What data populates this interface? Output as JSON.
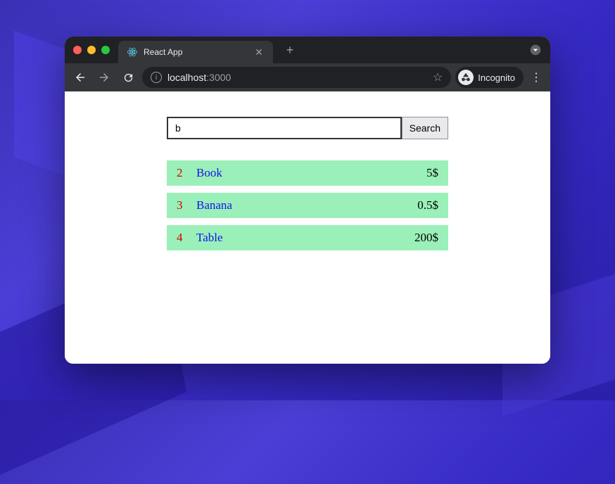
{
  "browser": {
    "tab_title": "React App",
    "url_host": "localhost",
    "url_port": ":3000",
    "incognito_label": "Incognito"
  },
  "app": {
    "search_value": "b",
    "search_button": "Search",
    "results": [
      {
        "id": "2",
        "name": "Book",
        "price": "5$"
      },
      {
        "id": "3",
        "name": "Banana",
        "price": "0.5$"
      },
      {
        "id": "4",
        "name": "Table",
        "price": "200$"
      }
    ]
  }
}
